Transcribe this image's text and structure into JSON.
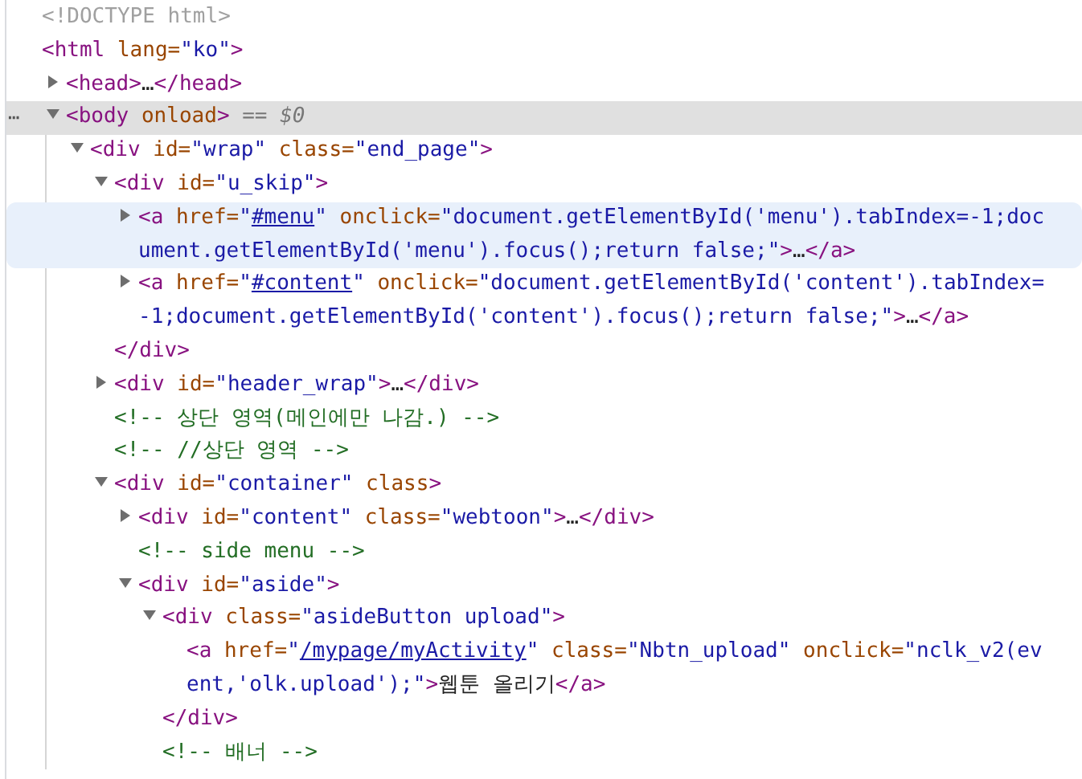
{
  "tree": [
    {
      "lines": [
        {
          "tokens": [
            {
              "kind": "doctype",
              "text": "<!DOCTYPE html>"
            }
          ]
        }
      ],
      "selected": false,
      "hovered": false
    },
    {
      "lines": [
        {
          "tokens": [
            {
              "kind": "tag",
              "text": "<html"
            },
            {
              "kind": "attr",
              "text": " lang="
            },
            {
              "kind": "val",
              "text": "\"ko\""
            },
            {
              "kind": "tag",
              "text": ">"
            }
          ]
        }
      ],
      "selected": false,
      "hovered": false,
      "children": [
        {
          "lines": [
            {
              "tokens": [
                {
                  "kind": "tag",
                  "text": "<head>"
                },
                {
                  "kind": "text",
                  "text": "…"
                },
                {
                  "kind": "tag",
                  "text": "</head>"
                }
              ]
            }
          ],
          "expanded": false,
          "selected": false,
          "hovered": false
        },
        {
          "lines": [
            {
              "tokens": [
                {
                  "kind": "tag",
                  "text": "<body"
                },
                {
                  "kind": "attr",
                  "text": " onload"
                },
                {
                  "kind": "tag",
                  "text": ">"
                },
                {
                  "kind": "marker",
                  "text": " == $0"
                }
              ]
            }
          ],
          "more": "⋯",
          "expanded": true,
          "selected": true,
          "hovered": false,
          "children": [
            {
              "lines": [
                {
                  "tokens": [
                    {
                      "kind": "tag",
                      "text": "<div"
                    },
                    {
                      "kind": "attr",
                      "text": " id="
                    },
                    {
                      "kind": "val",
                      "text": "\"wrap\""
                    },
                    {
                      "kind": "attr",
                      "text": " class="
                    },
                    {
                      "kind": "val",
                      "text": "\"end_page\""
                    },
                    {
                      "kind": "tag",
                      "text": ">"
                    }
                  ]
                }
              ],
              "expanded": true,
              "selected": false,
              "hovered": false,
              "children": [
                {
                  "lines": [
                    {
                      "tokens": [
                        {
                          "kind": "tag",
                          "text": "<div"
                        },
                        {
                          "kind": "attr",
                          "text": " id="
                        },
                        {
                          "kind": "val",
                          "text": "\"u_skip\""
                        },
                        {
                          "kind": "tag",
                          "text": ">"
                        }
                      ]
                    }
                  ],
                  "expanded": true,
                  "selected": false,
                  "hovered": false,
                  "close": {
                    "tokens": [
                      {
                        "kind": "tag",
                        "text": "</div>"
                      }
                    ]
                  },
                  "children": [
                    {
                      "lines": [
                        {
                          "tokens": [
                            {
                              "kind": "tag",
                              "text": "<a"
                            },
                            {
                              "kind": "attr",
                              "text": " href="
                            },
                            {
                              "kind": "val",
                              "text": "\""
                            },
                            {
                              "kind": "link",
                              "text": "#menu"
                            },
                            {
                              "kind": "val",
                              "text": "\""
                            },
                            {
                              "kind": "attr",
                              "text": " onclick="
                            },
                            {
                              "kind": "val",
                              "text": "\"document.getElementById('menu').tabIndex=-1;doc"
                            }
                          ]
                        },
                        {
                          "tokens": [
                            {
                              "kind": "val",
                              "text": "ument.getElementById('menu').focus();return false;\""
                            },
                            {
                              "kind": "tag",
                              "text": ">"
                            },
                            {
                              "kind": "text",
                              "text": "…"
                            },
                            {
                              "kind": "tag",
                              "text": "</a>"
                            }
                          ]
                        }
                      ],
                      "expanded": false,
                      "selected": false,
                      "hovered": true
                    },
                    {
                      "lines": [
                        {
                          "tokens": [
                            {
                              "kind": "tag",
                              "text": "<a"
                            },
                            {
                              "kind": "attr",
                              "text": " href="
                            },
                            {
                              "kind": "val",
                              "text": "\""
                            },
                            {
                              "kind": "link",
                              "text": "#content"
                            },
                            {
                              "kind": "val",
                              "text": "\""
                            },
                            {
                              "kind": "attr",
                              "text": " onclick="
                            },
                            {
                              "kind": "val",
                              "text": "\"document.getElementById('content').tabIndex="
                            }
                          ]
                        },
                        {
                          "tokens": [
                            {
                              "kind": "val",
                              "text": "-1;document.getElementById('content').focus();return false;\""
                            },
                            {
                              "kind": "tag",
                              "text": ">"
                            },
                            {
                              "kind": "text",
                              "text": "…"
                            },
                            {
                              "kind": "tag",
                              "text": "</a>"
                            }
                          ]
                        }
                      ],
                      "expanded": false,
                      "selected": false,
                      "hovered": false
                    }
                  ]
                },
                {
                  "lines": [
                    {
                      "tokens": [
                        {
                          "kind": "tag",
                          "text": "<div"
                        },
                        {
                          "kind": "attr",
                          "text": " id="
                        },
                        {
                          "kind": "val",
                          "text": "\"header_wrap\""
                        },
                        {
                          "kind": "tag",
                          "text": ">"
                        },
                        {
                          "kind": "text",
                          "text": "…"
                        },
                        {
                          "kind": "tag",
                          "text": "</div>"
                        }
                      ]
                    }
                  ],
                  "expanded": false,
                  "selected": false,
                  "hovered": false
                },
                {
                  "lines": [
                    {
                      "tokens": [
                        {
                          "kind": "comment",
                          "text": "<!-- 상단 영역(메인에만 나감.) -->"
                        }
                      ]
                    }
                  ],
                  "selected": false,
                  "hovered": false
                },
                {
                  "lines": [
                    {
                      "tokens": [
                        {
                          "kind": "comment",
                          "text": "<!-- //상단 영역 -->"
                        }
                      ]
                    }
                  ],
                  "selected": false,
                  "hovered": false
                },
                {
                  "lines": [
                    {
                      "tokens": [
                        {
                          "kind": "tag",
                          "text": "<div"
                        },
                        {
                          "kind": "attr",
                          "text": " id="
                        },
                        {
                          "kind": "val",
                          "text": "\"container\""
                        },
                        {
                          "kind": "attr",
                          "text": " class"
                        },
                        {
                          "kind": "tag",
                          "text": ">"
                        }
                      ]
                    }
                  ],
                  "expanded": true,
                  "selected": false,
                  "hovered": false,
                  "children": [
                    {
                      "lines": [
                        {
                          "tokens": [
                            {
                              "kind": "tag",
                              "text": "<div"
                            },
                            {
                              "kind": "attr",
                              "text": " id="
                            },
                            {
                              "kind": "val",
                              "text": "\"content\""
                            },
                            {
                              "kind": "attr",
                              "text": " class="
                            },
                            {
                              "kind": "val",
                              "text": "\"webtoon\""
                            },
                            {
                              "kind": "tag",
                              "text": ">"
                            },
                            {
                              "kind": "text",
                              "text": "…"
                            },
                            {
                              "kind": "tag",
                              "text": "</div>"
                            }
                          ]
                        }
                      ],
                      "expanded": false,
                      "selected": false,
                      "hovered": false
                    },
                    {
                      "lines": [
                        {
                          "tokens": [
                            {
                              "kind": "comment",
                              "text": "<!-- side menu -->"
                            }
                          ]
                        }
                      ],
                      "selected": false,
                      "hovered": false
                    },
                    {
                      "lines": [
                        {
                          "tokens": [
                            {
                              "kind": "tag",
                              "text": "<div"
                            },
                            {
                              "kind": "attr",
                              "text": " id="
                            },
                            {
                              "kind": "val",
                              "text": "\"aside\""
                            },
                            {
                              "kind": "tag",
                              "text": ">"
                            }
                          ]
                        }
                      ],
                      "expanded": true,
                      "selected": false,
                      "hovered": false,
                      "children": [
                        {
                          "lines": [
                            {
                              "tokens": [
                                {
                                  "kind": "tag",
                                  "text": "<div"
                                },
                                {
                                  "kind": "attr",
                                  "text": " class="
                                },
                                {
                                  "kind": "val",
                                  "text": "\"asideButton upload\""
                                },
                                {
                                  "kind": "tag",
                                  "text": ">"
                                }
                              ]
                            }
                          ],
                          "expanded": true,
                          "selected": false,
                          "hovered": false,
                          "close": {
                            "tokens": [
                              {
                                "kind": "tag",
                                "text": "</div>"
                              }
                            ]
                          },
                          "children": [
                            {
                              "lines": [
                                {
                                  "tokens": [
                                    {
                                      "kind": "tag",
                                      "text": "<a"
                                    },
                                    {
                                      "kind": "attr",
                                      "text": " href="
                                    },
                                    {
                                      "kind": "val",
                                      "text": "\""
                                    },
                                    {
                                      "kind": "link",
                                      "text": "/mypage/myActivity"
                                    },
                                    {
                                      "kind": "val",
                                      "text": "\""
                                    },
                                    {
                                      "kind": "attr",
                                      "text": " class="
                                    },
                                    {
                                      "kind": "val",
                                      "text": "\"Nbtn_upload\""
                                    },
                                    {
                                      "kind": "attr",
                                      "text": " onclick="
                                    },
                                    {
                                      "kind": "val",
                                      "text": "\"nclk_v2(ev"
                                    }
                                  ]
                                },
                                {
                                  "tokens": [
                                    {
                                      "kind": "val",
                                      "text": "ent,'olk.upload');\""
                                    },
                                    {
                                      "kind": "tag",
                                      "text": ">"
                                    },
                                    {
                                      "kind": "text",
                                      "text": "웹툰 올리기"
                                    },
                                    {
                                      "kind": "tag",
                                      "text": "</a>"
                                    }
                                  ]
                                }
                              ],
                              "selected": false,
                              "hovered": false
                            }
                          ]
                        },
                        {
                          "lines": [
                            {
                              "tokens": [
                                {
                                  "kind": "comment",
                                  "text": "<!-- 배너 -->"
                                }
                              ]
                            }
                          ],
                          "selected": false,
                          "hovered": false
                        }
                      ]
                    }
                  ]
                }
              ]
            }
          ]
        }
      ]
    }
  ]
}
